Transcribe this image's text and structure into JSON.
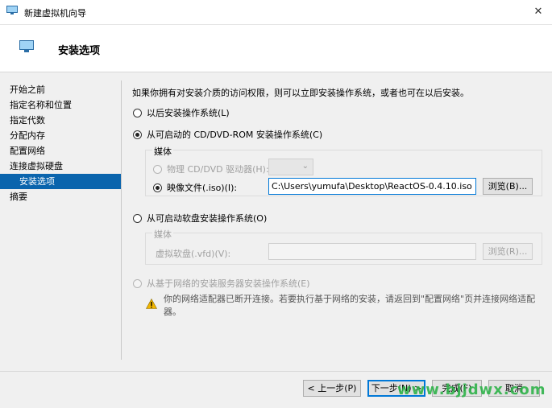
{
  "window": {
    "title": "新建虚拟机向导"
  },
  "header": {
    "title": "安装选项"
  },
  "nav": {
    "items": [
      {
        "label": "开始之前"
      },
      {
        "label": "指定名称和位置"
      },
      {
        "label": "指定代数"
      },
      {
        "label": "分配内存"
      },
      {
        "label": "配置网络"
      },
      {
        "label": "连接虚拟硬盘"
      },
      {
        "label": "安装选项"
      },
      {
        "label": "摘要"
      }
    ]
  },
  "content": {
    "intro": "如果你拥有对安装介质的访问权限，则可以立即安装操作系统，或者也可在以后安装。",
    "option_later": "以后安装操作系统(L)",
    "option_cd": "从可启动的 CD/DVD-ROM 安装操作系统(C)",
    "cd_group": {
      "label": "媒体",
      "physical_label": "物理 CD/DVD 驱动器(H):",
      "image_label": "映像文件(.iso)(I):",
      "image_path": "C:\\Users\\yumufa\\Desktop\\ReactOS-0.4.10.iso",
      "browse": "浏览(B)..."
    },
    "option_floppy": "从可启动软盘安装操作系统(O)",
    "floppy_group": {
      "label": "媒体",
      "vfd_label": "虚拟软盘(.vfd)(V):",
      "vfd_path": "",
      "browse": "浏览(R)..."
    },
    "option_network": "从基于网络的安装服务器安装操作系统(E)",
    "warning": "你的网络适配器已断开连接。若要执行基于网络的安装，请返回到\"配置网络\"页并连接网络适配器。"
  },
  "footer": {
    "prev": "< 上一步(P)",
    "next": "下一步(N) >",
    "finish": "完成(F)",
    "cancel": "取消"
  },
  "watermark": "www.bjjdwx.com",
  "colors": {
    "accent": "#0a64ad",
    "focus": "#0078d7",
    "watermark": "#2fb34a"
  }
}
